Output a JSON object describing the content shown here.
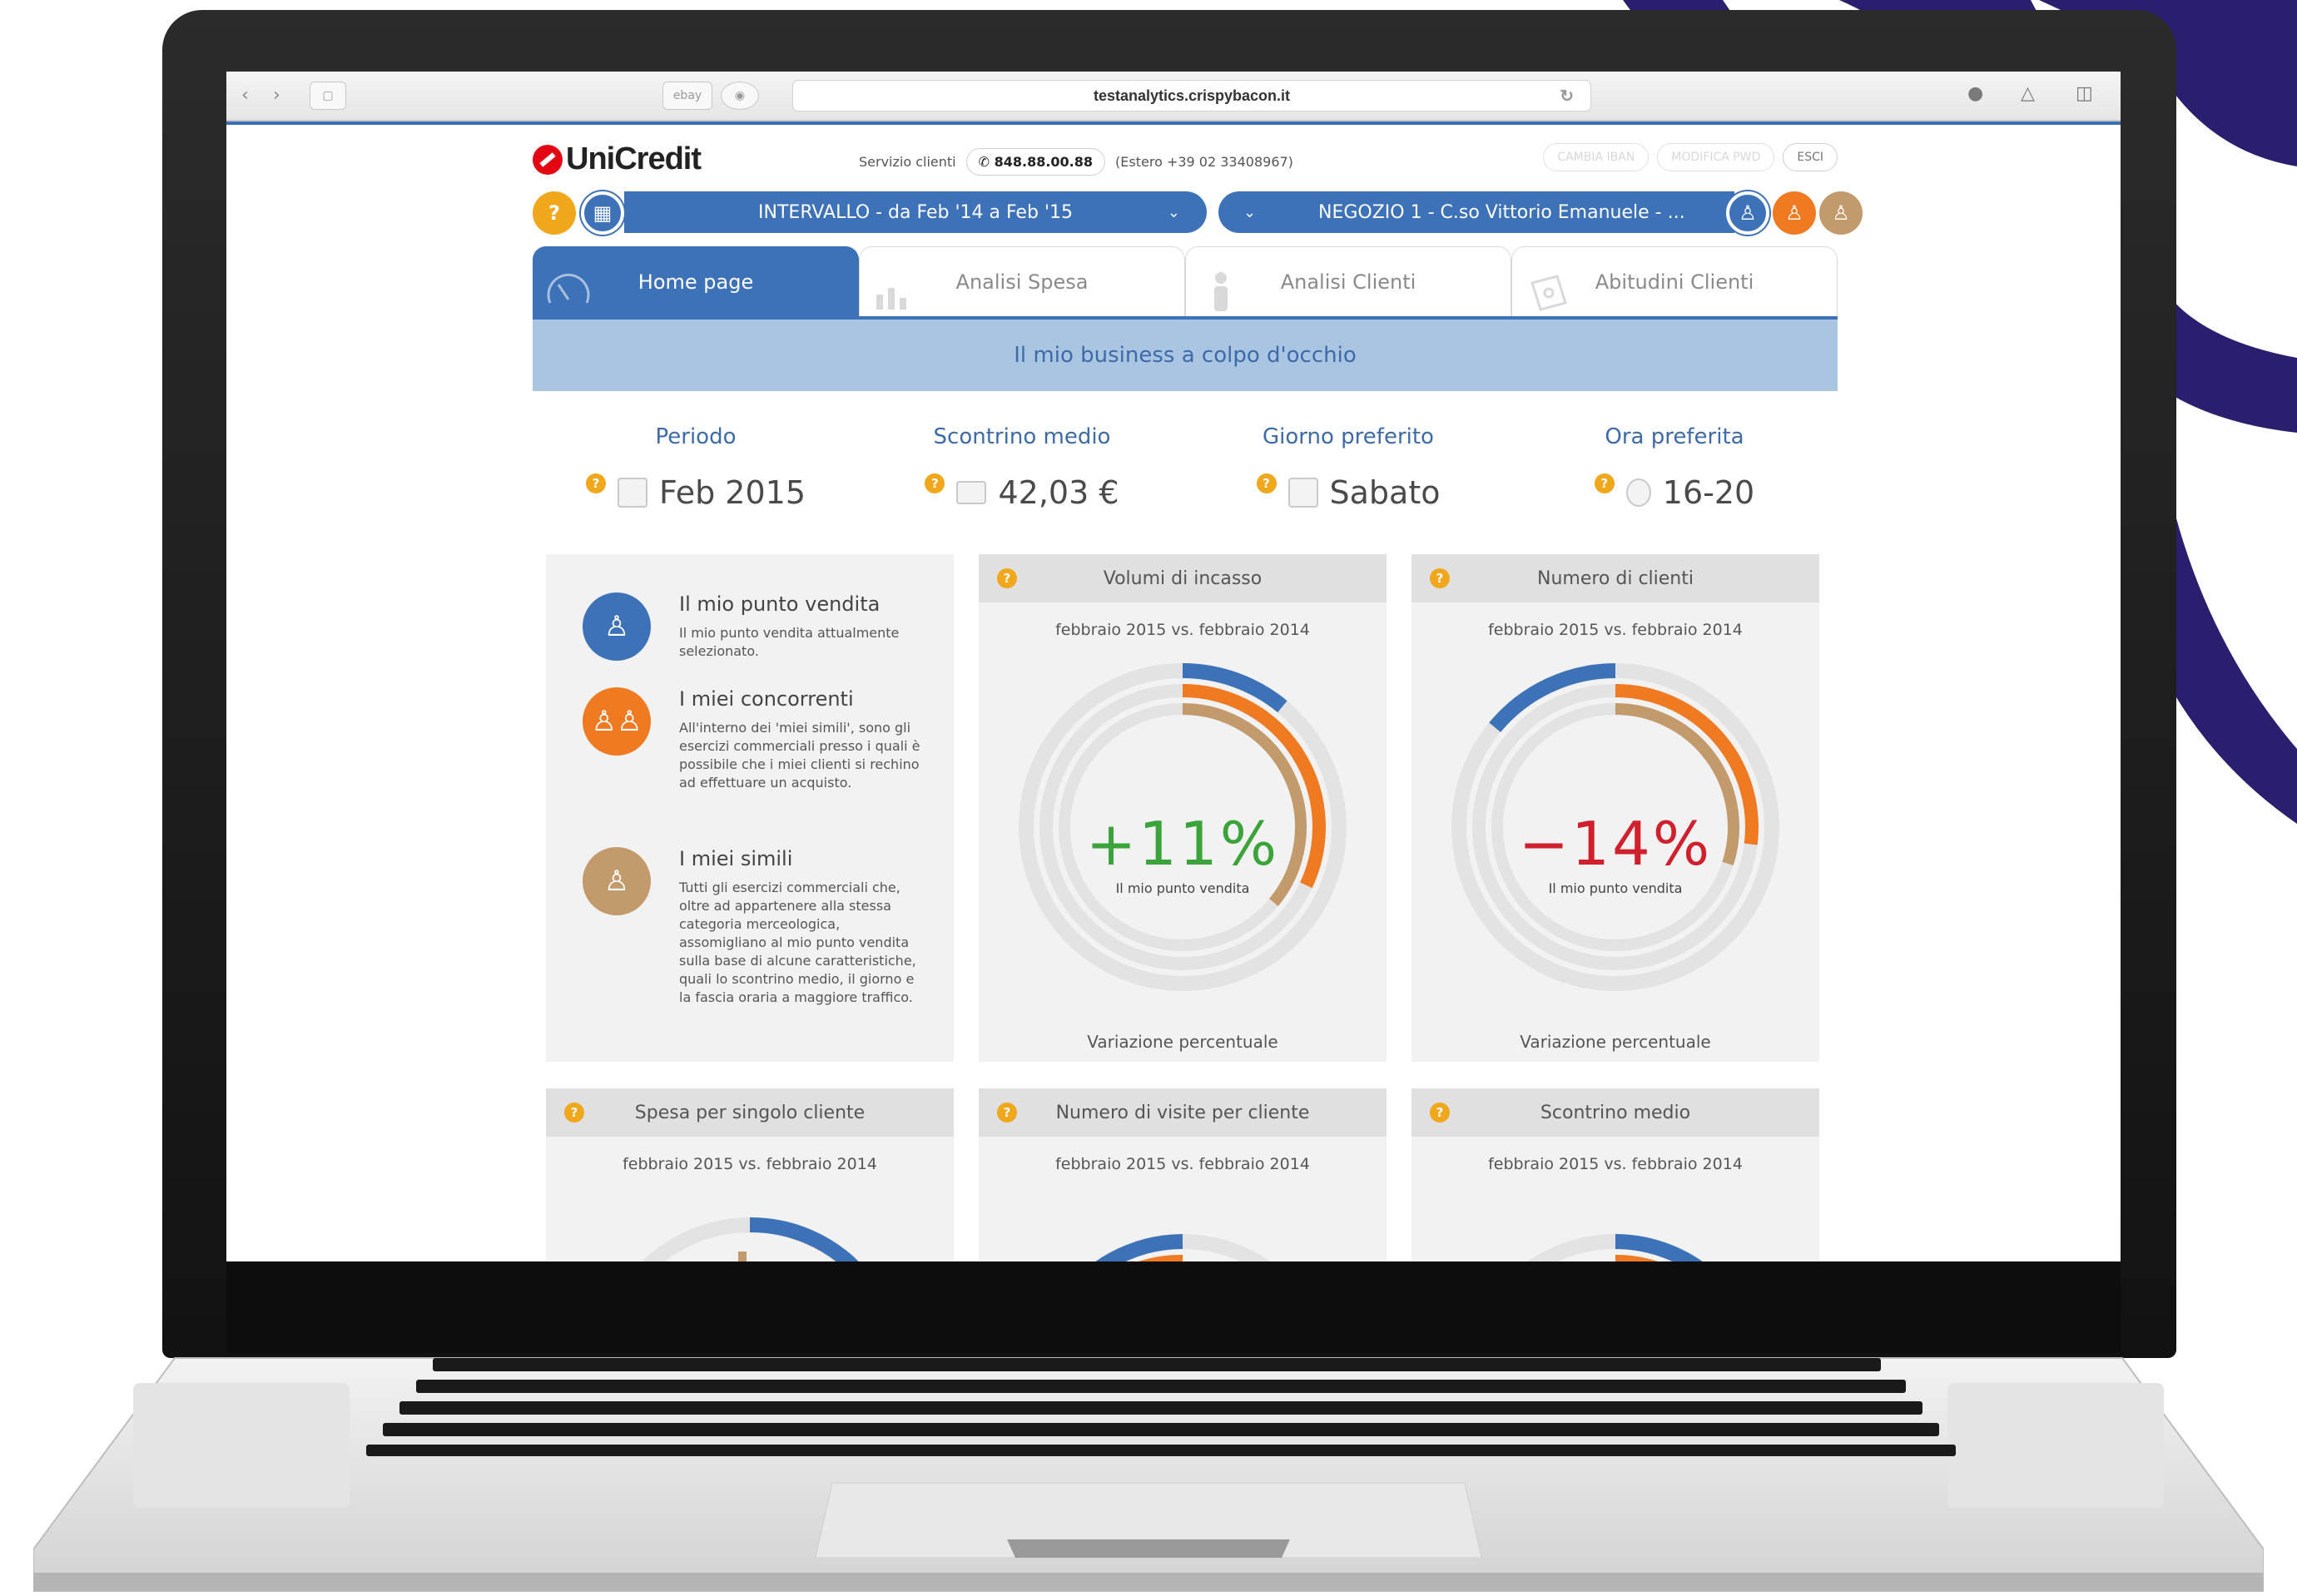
{
  "browser": {
    "back_icon": "chevron-left-icon",
    "forward_icon": "chevron-right-icon",
    "sidebar_icon": "sidebar-icon",
    "tab1_label": "ebay",
    "tab2_icon": "site-icon",
    "url": "testanalytics.crispybacon.it",
    "reload_icon": "reload-icon",
    "download_icon": "download-icon",
    "share_icon": "share-icon",
    "tabs_icon": "tabs-icon"
  },
  "header": {
    "logo": "UniCredit",
    "service_label": "Servizio clienti",
    "phone": "848.88.00.88",
    "abroad": "(Estero +39 02 33408967)",
    "action1": "CAMBIA IBAN",
    "action2": "MODIFICA PWD",
    "logout": "ESCI"
  },
  "filters": {
    "help": "?",
    "calendar_icon": "calendar-icon",
    "interval_label": "INTERVALLO - da Feb '14 a Feb '15",
    "store_label": "NEGOZIO 1 - C.so Vittorio Emanuele - ...",
    "toggles": [
      "my-store",
      "competitors",
      "similar"
    ]
  },
  "tabs": [
    {
      "label": "Home page",
      "active": true
    },
    {
      "label": "Analisi Spesa",
      "active": false
    },
    {
      "label": "Analisi Clienti",
      "active": false
    },
    {
      "label": "Abitudini Clienti",
      "active": false
    }
  ],
  "banner": "Il mio business a colpo d'occhio",
  "kpis": [
    {
      "label": "Periodo",
      "value": "Feb 2015",
      "icon": "calendar-icon"
    },
    {
      "label": "Scontrino medio",
      "value": "42,03 €",
      "icon": "card-icon"
    },
    {
      "label": "Giorno preferito",
      "value": "Sabato",
      "icon": "calendar-day-icon"
    },
    {
      "label": "Ora preferita",
      "value": "16-20",
      "icon": "clock-icon"
    }
  ],
  "legend": [
    {
      "title": "Il mio punto vendita",
      "text": "Il mio punto vendita attualmente selezionato."
    },
    {
      "title": "I miei concorrenti",
      "text": "All'interno dei 'miei simili', sono gli esercizi commerciali presso i quali è possibile che i miei clienti si rechino ad effettuare un acquisto."
    },
    {
      "title": "I miei simili",
      "text": "Tutti gli esercizi commerciali che, oltre ad appartenere alla stessa categoria merceologica, assomigliano al mio punto vendita sulla base di alcune caratteristiche, quali lo scontrino medio, il giorno e la fascia oraria a maggiore traffico."
    }
  ],
  "cards": [
    {
      "title": "Volumi di incasso",
      "subtitle": "febbraio 2015 vs. febbraio 2014",
      "value": "+11%",
      "caption": "Il mio punto vendita",
      "footer": "Variazione percentuale",
      "rings": {
        "store": 0.11,
        "competitors": 0.32,
        "similar": 0.36
      }
    },
    {
      "title": "Numero di clienti",
      "subtitle": "febbraio 2015 vs. febbraio 2014",
      "value": "−14%",
      "caption": "Il mio punto vendita",
      "footer": "Variazione percentuale",
      "rings": {
        "store": -0.14,
        "competitors": 0.27,
        "similar": 0.3
      }
    },
    {
      "title": "Spesa per singolo cliente",
      "subtitle": "febbraio 2015 vs. febbraio 2014"
    },
    {
      "title": "Numero di visite per cliente",
      "subtitle": "febbraio 2015 vs. febbraio 2014"
    },
    {
      "title": "Scontrino medio",
      "subtitle": "febbraio 2015 vs. febbraio 2014"
    }
  ],
  "colors": {
    "blue": "#3d72b8",
    "orange": "#f07a22",
    "tan": "#c39a6b",
    "help": "#f0a71c",
    "positive": "#3aa33a",
    "negative": "#d0202e"
  }
}
